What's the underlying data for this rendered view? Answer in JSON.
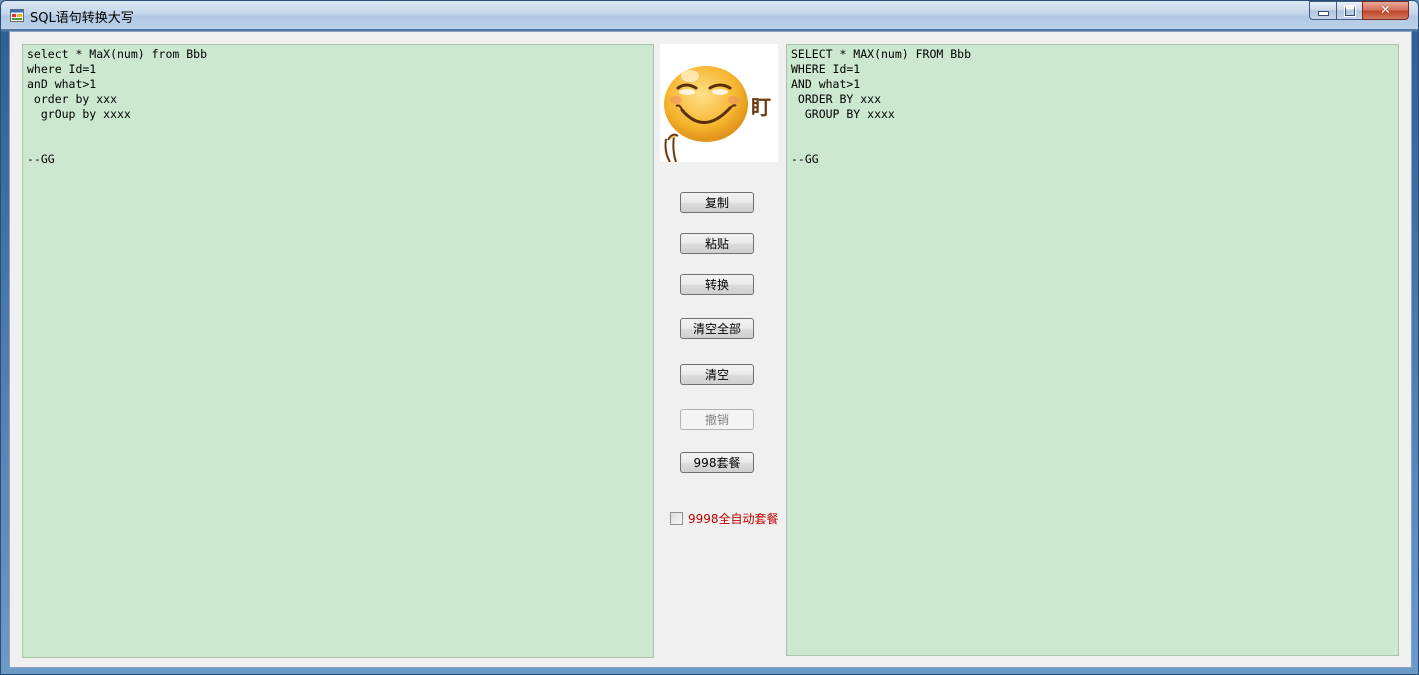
{
  "window": {
    "title": "SQL语句转换大写",
    "close_glyph": "✕"
  },
  "input": {
    "text": "select * MaX(num) from Bbb\nwhere Id=1\nanD what>1\n order by xxx\n  grOup by xxxx\n\n\n--GG"
  },
  "output": {
    "text": "SELECT * MAX(num) FROM Bbb\nWHERE Id=1\nAND what>1\n ORDER BY xxx\n  GROUP BY xxxx\n\n\n--GG"
  },
  "image": {
    "stamp_text": "盯"
  },
  "buttons": {
    "copy": "复制",
    "paste": "粘贴",
    "convert": "转换",
    "clear_all": "清空全部",
    "clear": "清空",
    "undo": "撤销",
    "package_998": "998套餐"
  },
  "auto_package": {
    "label": "9998全自动套餐",
    "checked": false,
    "label_color": "#c00000"
  },
  "colors": {
    "textbox_bg": "#cce8cf",
    "client_bg": "#f0f0f0"
  },
  "icons": [
    "app-icon",
    "minimize-icon",
    "maximize-icon",
    "close-icon",
    "staring-face-emoji"
  ]
}
